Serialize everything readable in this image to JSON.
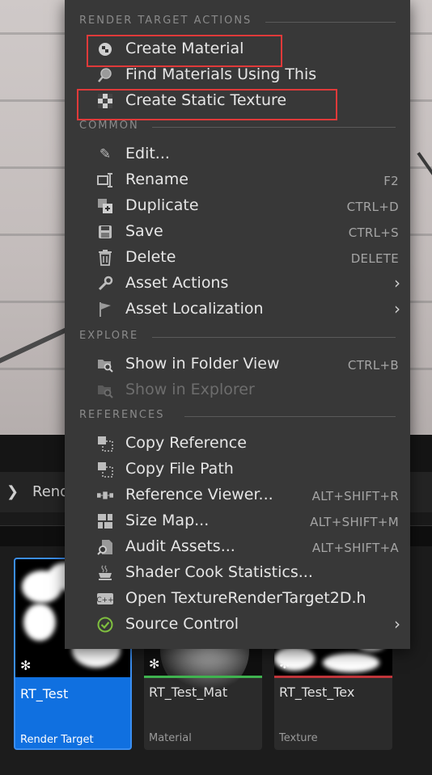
{
  "content_browser": {
    "path_text": "Rend",
    "assets": [
      {
        "name": "RT_Test",
        "type": "Render Target",
        "accent": "#1070e0"
      },
      {
        "name": "RT_Test_Mat",
        "type": "Material",
        "accent": "#3fb34f"
      },
      {
        "name": "RT_Test_Tex",
        "type": "Texture",
        "accent": "#c0353a"
      }
    ]
  },
  "menu": {
    "sections": {
      "render_target_actions": "RENDER TARGET ACTIONS",
      "common": "COMMON",
      "explore": "EXPLORE",
      "references": "REFERENCES"
    },
    "render_target_actions": [
      {
        "label": "Create Material",
        "icon": "material-sphere-icon"
      },
      {
        "label": "Find Materials Using This",
        "icon": "magnifier-icon"
      },
      {
        "label": "Create Static Texture",
        "icon": "checker-texture-icon"
      }
    ],
    "common": [
      {
        "label": "Edit...",
        "icon": "pencil-icon",
        "shortcut": ""
      },
      {
        "label": "Rename",
        "icon": "rename-icon",
        "shortcut": "F2"
      },
      {
        "label": "Duplicate",
        "icon": "duplicate-icon",
        "shortcut": "CTRL+D"
      },
      {
        "label": "Save",
        "icon": "save-icon",
        "shortcut": "CTRL+S"
      },
      {
        "label": "Delete",
        "icon": "trash-icon",
        "shortcut": "DELETE"
      },
      {
        "label": "Asset Actions",
        "icon": "wrench-icon",
        "submenu": true
      },
      {
        "label": "Asset Localization",
        "icon": "flag-icon",
        "submenu": true
      }
    ],
    "explore": [
      {
        "label": "Show in Folder View",
        "icon": "folder-search-icon",
        "shortcut": "CTRL+B",
        "enabled": true
      },
      {
        "label": "Show in Explorer",
        "icon": "folder-search-icon",
        "shortcut": "",
        "enabled": false
      }
    ],
    "references": [
      {
        "label": "Copy Reference",
        "icon": "copy-reference-icon",
        "shortcut": ""
      },
      {
        "label": "Copy File Path",
        "icon": "copy-path-icon",
        "shortcut": ""
      },
      {
        "label": "Reference Viewer...",
        "icon": "reference-viewer-icon",
        "shortcut": "ALT+SHIFT+R"
      },
      {
        "label": "Size Map...",
        "icon": "size-map-icon",
        "shortcut": "ALT+SHIFT+M"
      },
      {
        "label": "Audit Assets...",
        "icon": "audit-icon",
        "shortcut": "ALT+SHIFT+A"
      },
      {
        "label": "Shader Cook Statistics...",
        "icon": "teacup-icon",
        "shortcut": ""
      },
      {
        "label": "Open TextureRenderTarget2D.h",
        "icon": "cpp-file-icon",
        "shortcut": ""
      },
      {
        "label": "Source Control",
        "icon": "check-circle-icon",
        "submenu": true
      }
    ]
  },
  "colors": {
    "menu_bg": "#383838",
    "highlight_border": "#e03a3a",
    "selected_tile": "#1070e0",
    "source_control_check": "#7fbf3f"
  }
}
